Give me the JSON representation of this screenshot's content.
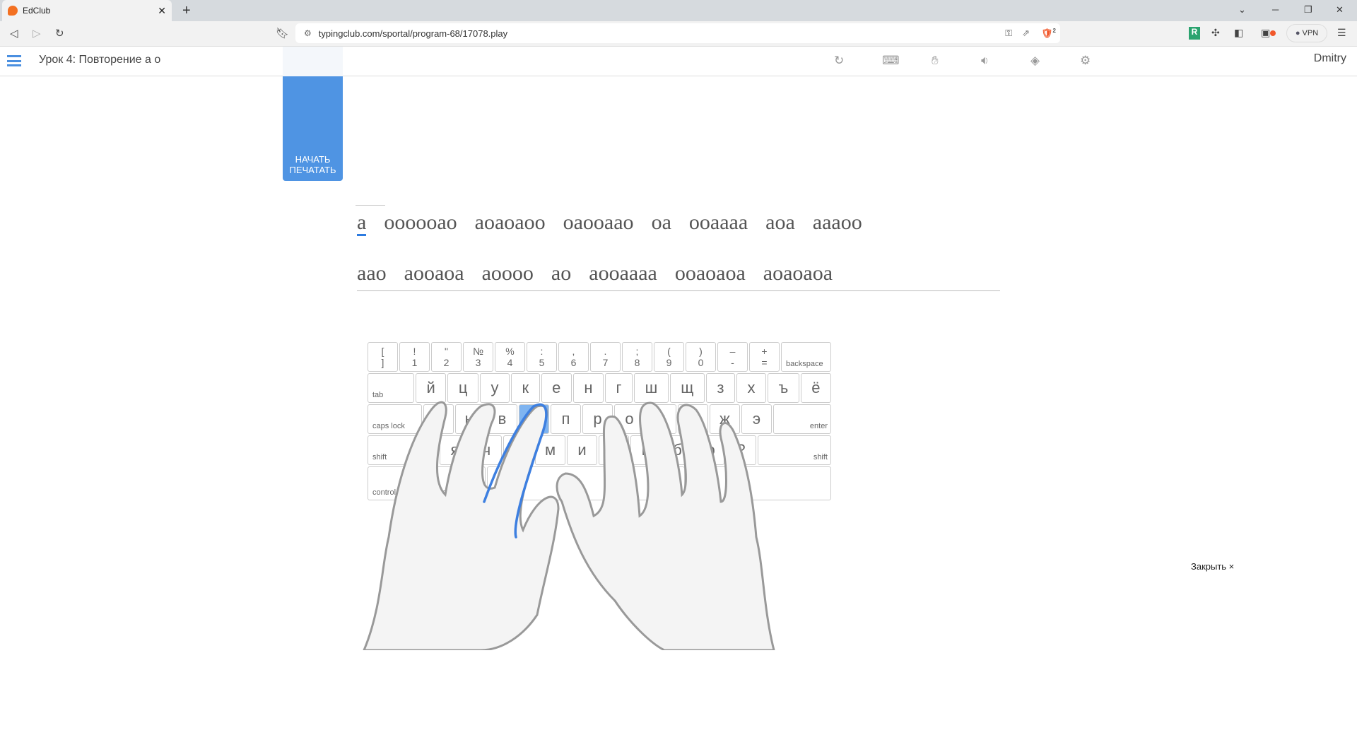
{
  "browser": {
    "tab_title": "EdClub",
    "url": "typingclub.com/sportal/program-68/17078.play",
    "vpn_label": "VPN",
    "shields_count": "2"
  },
  "header": {
    "lesson_title": "Урок 4: Повторение а о",
    "user": "Dmitry",
    "tools": [
      "reload-icon",
      "keyboard-icon",
      "hand-icon",
      "sound-icon",
      "paint-bucket-icon",
      "gear-icon"
    ]
  },
  "start_button": {
    "line1": "НАЧАТЬ",
    "line2": "ПЕЧАТАТЬ"
  },
  "text": {
    "line1": [
      "а",
      "оооооао",
      "аоаоаоо",
      "оаооаао",
      "оа",
      "ооаааа",
      "аоа",
      "аааоо"
    ],
    "line2": [
      "аао",
      "аооаоа",
      "аоооо",
      "ао",
      "аооаааа",
      "ооаоаоа",
      "аоаоаоа"
    ]
  },
  "keyboard": {
    "row1": [
      [
        "[",
        "]"
      ],
      [
        "!",
        "1"
      ],
      [
        "\"",
        "2"
      ],
      [
        "№",
        "3"
      ],
      [
        "%",
        "4"
      ],
      [
        ":",
        "5"
      ],
      [
        ",",
        "6"
      ],
      [
        ".",
        "7"
      ],
      [
        ";",
        "8"
      ],
      [
        "(",
        "9"
      ],
      [
        ")",
        "0"
      ],
      [
        "–",
        "-"
      ],
      [
        "+",
        "="
      ]
    ],
    "backspace": "backspace",
    "tab": "tab",
    "row2": [
      "й",
      "ц",
      "у",
      "к",
      "е",
      "н",
      "г",
      "ш",
      "щ",
      "з",
      "х",
      "ъ",
      "ё"
    ],
    "caps": "caps lock",
    "row3": [
      "ф",
      "ы",
      "в",
      "а",
      "п",
      "р",
      "о",
      "л",
      "д",
      "ж",
      "э"
    ],
    "enter": "enter",
    "shift": "shift",
    "row4": [
      "я",
      "ч",
      "с",
      "м",
      "и",
      "т",
      "ь",
      "б",
      "ю",
      "?"
    ],
    "control": "control",
    "option": "option",
    "space": "space",
    "highlighted_key": "а",
    "highlight_color": "#7fb4f0"
  },
  "close_label": "Закрыть ×"
}
